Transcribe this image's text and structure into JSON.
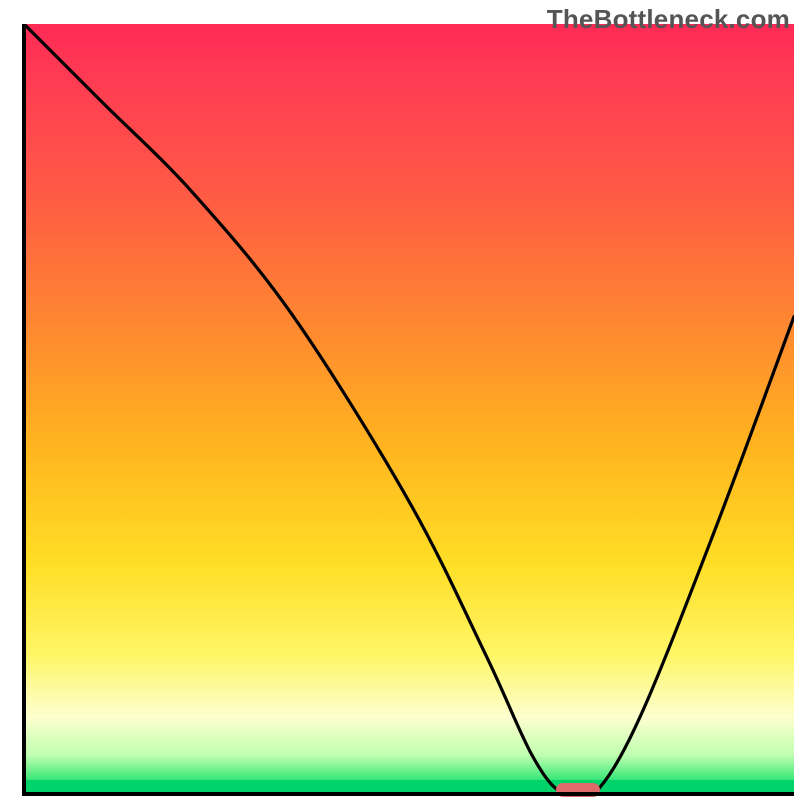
{
  "watermark": "TheBottleneck.com",
  "colors": {
    "gradient_top": "#ff2a55",
    "gradient_mid": "#ffde25",
    "gradient_bottom": "#00d36a",
    "curve": "#000000",
    "marker": "#e06a6a",
    "axes": "#000000"
  },
  "chart_data": {
    "type": "line",
    "title": "",
    "xlabel": "",
    "ylabel": "",
    "xlim": [
      0,
      100
    ],
    "ylim": [
      0,
      100
    ],
    "series": [
      {
        "name": "bottleneck-curve",
        "x": [
          0,
          10,
          22,
          35,
          50,
          60,
          66,
          70,
          74,
          80,
          90,
          100
        ],
        "values": [
          100,
          90,
          78,
          62,
          38,
          18,
          5,
          0,
          0,
          10,
          35,
          62
        ]
      }
    ],
    "marker": {
      "x": 72,
      "y": 0
    },
    "grid": false,
    "legend": false
  }
}
